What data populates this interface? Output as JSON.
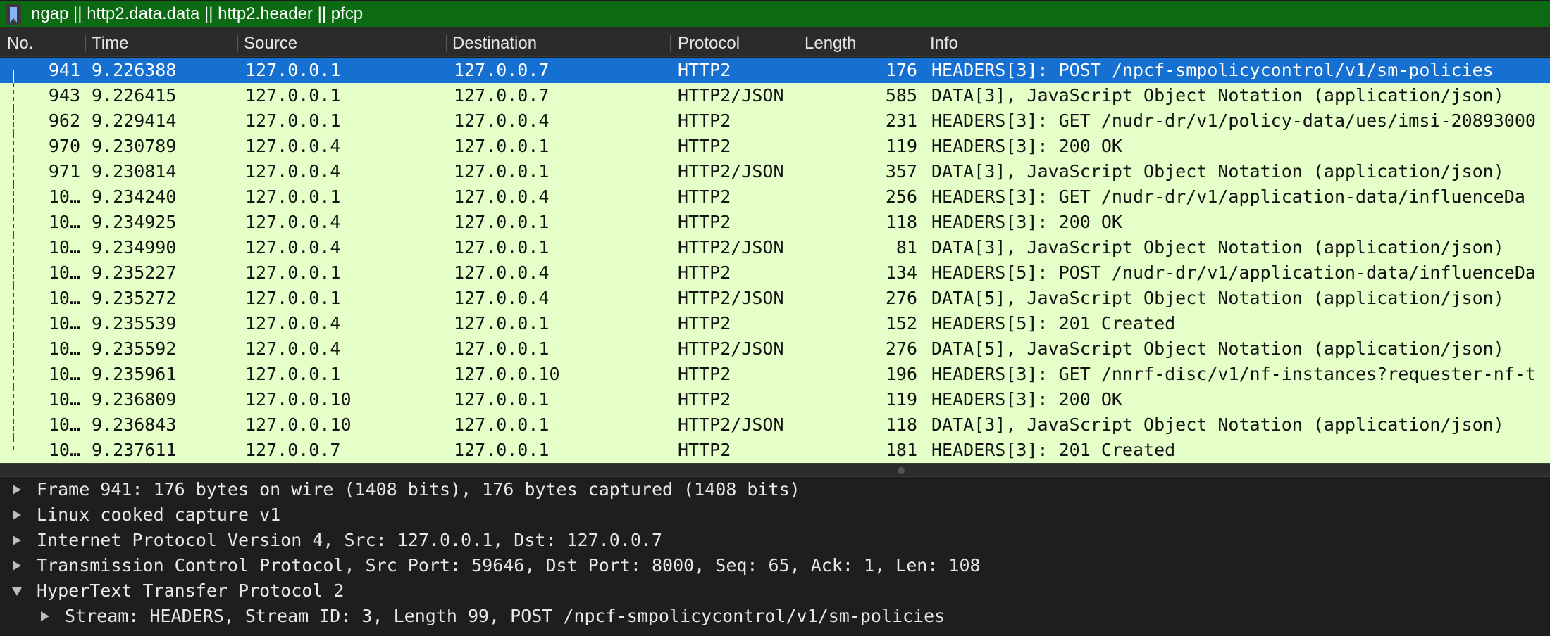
{
  "filter": {
    "expression": "ngap || http2.data.data || http2.header || pfcp",
    "bookmark_icon": "bookmark-icon",
    "background_color": "#0b6a12"
  },
  "columns": {
    "no": "No.",
    "time": "Time",
    "source": "Source",
    "destination": "Destination",
    "protocol": "Protocol",
    "length": "Length",
    "info": "Info"
  },
  "colors": {
    "row_background": "#e4ffc7",
    "selected_background": "#1670d2"
  },
  "packets": [
    {
      "no": "941",
      "time": "9.226388",
      "source": "127.0.0.1",
      "destination": "127.0.0.7",
      "protocol": "HTTP2",
      "length": "176",
      "info": "HEADERS[3]: POST /npcf-smpolicycontrol/v1/sm-policies"
    },
    {
      "no": "943",
      "time": "9.226415",
      "source": "127.0.0.1",
      "destination": "127.0.0.7",
      "protocol": "HTTP2/JSON",
      "length": "585",
      "info": "DATA[3], JavaScript Object Notation (application/json)"
    },
    {
      "no": "962",
      "time": "9.229414",
      "source": "127.0.0.1",
      "destination": "127.0.0.4",
      "protocol": "HTTP2",
      "length": "231",
      "info": "HEADERS[3]: GET /nudr-dr/v1/policy-data/ues/imsi-20893000"
    },
    {
      "no": "970",
      "time": "9.230789",
      "source": "127.0.0.4",
      "destination": "127.0.0.1",
      "protocol": "HTTP2",
      "length": "119",
      "info": "HEADERS[3]: 200 OK"
    },
    {
      "no": "971",
      "time": "9.230814",
      "source": "127.0.0.4",
      "destination": "127.0.0.1",
      "protocol": "HTTP2/JSON",
      "length": "357",
      "info": "DATA[3], JavaScript Object Notation (application/json)"
    },
    {
      "no": "10…",
      "time": "9.234240",
      "source": "127.0.0.1",
      "destination": "127.0.0.4",
      "protocol": "HTTP2",
      "length": "256",
      "info": "HEADERS[3]: GET /nudr-dr/v1/application-data/influenceDa"
    },
    {
      "no": "10…",
      "time": "9.234925",
      "source": "127.0.0.4",
      "destination": "127.0.0.1",
      "protocol": "HTTP2",
      "length": "118",
      "info": "HEADERS[3]: 200 OK"
    },
    {
      "no": "10…",
      "time": "9.234990",
      "source": "127.0.0.4",
      "destination": "127.0.0.1",
      "protocol": "HTTP2/JSON",
      "length": "81",
      "info": "DATA[3], JavaScript Object Notation (application/json)"
    },
    {
      "no": "10…",
      "time": "9.235227",
      "source": "127.0.0.1",
      "destination": "127.0.0.4",
      "protocol": "HTTP2",
      "length": "134",
      "info": "HEADERS[5]: POST /nudr-dr/v1/application-data/influenceDa"
    },
    {
      "no": "10…",
      "time": "9.235272",
      "source": "127.0.0.1",
      "destination": "127.0.0.4",
      "protocol": "HTTP2/JSON",
      "length": "276",
      "info": "DATA[5], JavaScript Object Notation (application/json)"
    },
    {
      "no": "10…",
      "time": "9.235539",
      "source": "127.0.0.4",
      "destination": "127.0.0.1",
      "protocol": "HTTP2",
      "length": "152",
      "info": "HEADERS[5]: 201 Created"
    },
    {
      "no": "10…",
      "time": "9.235592",
      "source": "127.0.0.4",
      "destination": "127.0.0.1",
      "protocol": "HTTP2/JSON",
      "length": "276",
      "info": "DATA[5], JavaScript Object Notation (application/json)"
    },
    {
      "no": "10…",
      "time": "9.235961",
      "source": "127.0.0.1",
      "destination": "127.0.0.10",
      "protocol": "HTTP2",
      "length": "196",
      "info": "HEADERS[3]: GET /nnrf-disc/v1/nf-instances?requester-nf-t"
    },
    {
      "no": "10…",
      "time": "9.236809",
      "source": "127.0.0.10",
      "destination": "127.0.0.1",
      "protocol": "HTTP2",
      "length": "119",
      "info": "HEADERS[3]: 200 OK"
    },
    {
      "no": "10…",
      "time": "9.236843",
      "source": "127.0.0.10",
      "destination": "127.0.0.1",
      "protocol": "HTTP2/JSON",
      "length": "118",
      "info": "DATA[3], JavaScript Object Notation (application/json)"
    },
    {
      "no": "10…",
      "time": "9.237611",
      "source": "127.0.0.7",
      "destination": "127.0.0.1",
      "protocol": "HTTP2",
      "length": "181",
      "info": "HEADERS[3]: 201 Created"
    }
  ],
  "details": [
    {
      "text": "Frame 941: 176 bytes on wire (1408 bits), 176 bytes captured (1408 bits)",
      "expanded": false,
      "level": 0
    },
    {
      "text": "Linux cooked capture v1",
      "expanded": false,
      "level": 0
    },
    {
      "text": "Internet Protocol Version 4, Src: 127.0.0.1, Dst: 127.0.0.7",
      "expanded": false,
      "level": 0
    },
    {
      "text": "Transmission Control Protocol, Src Port: 59646, Dst Port: 8000, Seq: 65, Ack: 1, Len: 108",
      "expanded": false,
      "level": 0
    },
    {
      "text": "HyperText Transfer Protocol 2",
      "expanded": true,
      "level": 0
    },
    {
      "text": "Stream: HEADERS, Stream ID: 3, Length 99, POST /npcf-smpolicycontrol/v1/sm-policies",
      "expanded": false,
      "level": 1
    }
  ]
}
